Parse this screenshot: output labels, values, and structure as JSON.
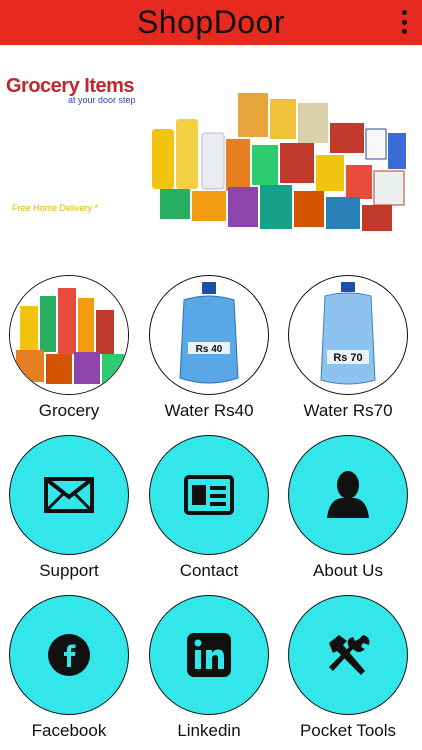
{
  "appbar": {
    "title": "ShopDoor",
    "menu_icon": "more-vert-icon"
  },
  "banner": {
    "brand_main": "Grocery Items",
    "brand_sub": "at your door step",
    "delivery": "Free Home Delivery *"
  },
  "tiles": [
    {
      "label": "Grocery",
      "icon": "grocery-image"
    },
    {
      "label": "Water Rs40",
      "icon": "water-can-image",
      "can_label": "Rs 40"
    },
    {
      "label": "Water Rs70",
      "icon": "water-can-image",
      "can_label": "Rs 70"
    },
    {
      "label": "Support",
      "icon": "envelope-icon"
    },
    {
      "label": "Contact",
      "icon": "contact-card-icon"
    },
    {
      "label": "About Us",
      "icon": "person-icon"
    },
    {
      "label": "Facebook",
      "icon": "facebook-icon"
    },
    {
      "label": "Linkedin",
      "icon": "linkedin-icon"
    },
    {
      "label": "Pocket Tools",
      "icon": "tools-icon"
    }
  ],
  "colors": {
    "appbar": "#e62a1f",
    "tile_cyan": "#33e6ea",
    "brand_red": "#c0282a"
  }
}
